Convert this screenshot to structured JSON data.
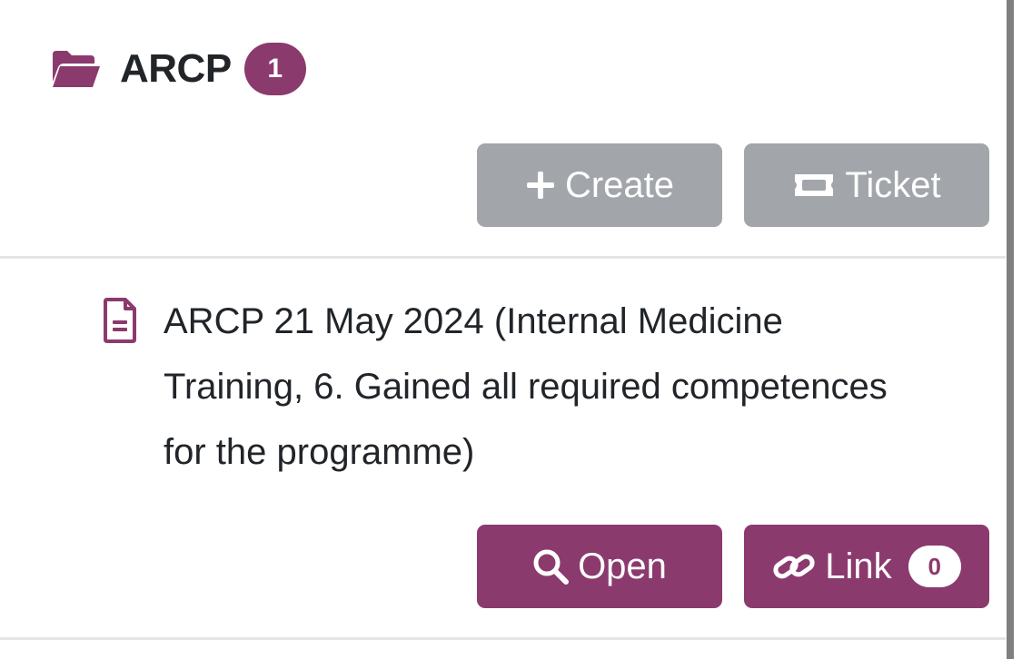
{
  "section": {
    "title": "ARCP",
    "count": "1",
    "icon": "folder-open-icon",
    "accent_color": "#8b3a6e"
  },
  "actions": {
    "create_label": "Create",
    "create_icon": "plus-icon",
    "ticket_label": "Ticket",
    "ticket_icon": "ticket-icon",
    "button_color": "#a2a6ab"
  },
  "items": [
    {
      "icon": "document-icon",
      "title": "ARCP 21 May 2024 (Internal Medicine Training, 6. Gained all required competences for the programme)",
      "open_label": "Open",
      "open_icon": "search-icon",
      "link_label": "Link",
      "link_icon": "link-icon",
      "link_count": "0"
    }
  ]
}
